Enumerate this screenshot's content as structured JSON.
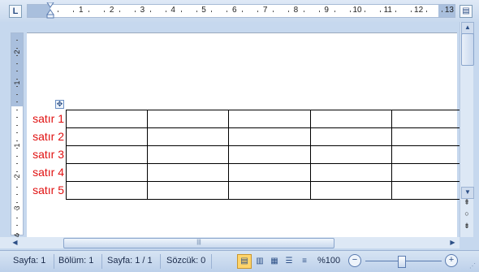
{
  "ruler": {
    "corner_label": "L",
    "numbers": [
      "1",
      "2",
      "3",
      "4",
      "5",
      "6",
      "7",
      "8",
      "9",
      "10",
      "11",
      "12",
      "13"
    ],
    "vertical_numbers": [
      "2",
      "1",
      "1",
      "2",
      "3",
      "4"
    ]
  },
  "table": {
    "row_labels": [
      "satır 1",
      "satır 2",
      "satır 3",
      "satır 4",
      "satır 5"
    ],
    "rows": 5,
    "columns": 5,
    "label_color": "#e01010"
  },
  "status_bar": {
    "page": "Sayfa: 1",
    "section": "Bölüm: 1",
    "page_of": "Sayfa: 1 / 1",
    "word_count": "Sözcük: 0",
    "zoom": "%100",
    "zoom_percent": 100
  },
  "icons": {
    "table_move": "move-cross-icon",
    "ruler_tab": "tab-stop-icon",
    "view_ruler": "view-ruler-icon",
    "browse_previous": "double-up-arrow-icon",
    "browse_object": "circle-icon",
    "browse_next": "double-down-arrow-icon"
  },
  "colors": {
    "accent_active_view": "#ffd46b",
    "chrome": "#c6d8ee"
  }
}
